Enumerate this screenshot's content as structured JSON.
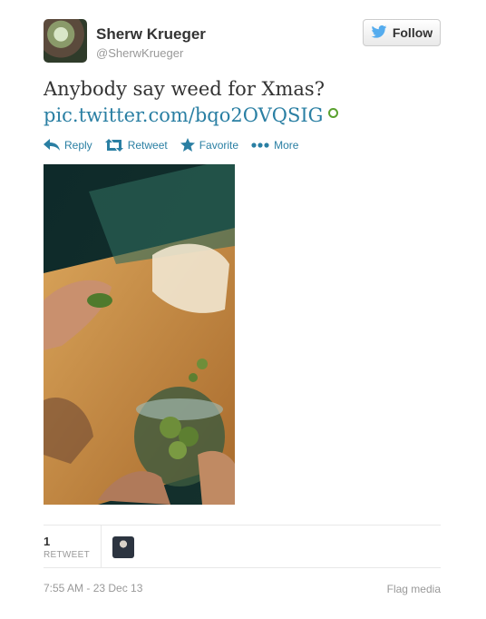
{
  "user": {
    "name": "Sherw Krueger",
    "handle": "@SherwKrueger"
  },
  "follow_button": {
    "label": "Follow"
  },
  "tweet": {
    "text": "Anybody say weed for Xmas?",
    "link": "pic.twitter.com/bqo2OVQSIG"
  },
  "actions": [
    {
      "label": "Reply",
      "icon": "reply-icon"
    },
    {
      "label": "Retweet",
      "icon": "retweet-icon"
    },
    {
      "label": "Favorite",
      "icon": "star-icon"
    },
    {
      "label": "More",
      "icon": "more-dots-icon"
    }
  ],
  "stats": {
    "retweet_count": "1",
    "retweet_label": "RETWEET"
  },
  "footer": {
    "timestamp": "7:55 AM - 23 Dec 13",
    "flag_media": "Flag media"
  },
  "colors": {
    "link": "#2a7fa3",
    "text": "#333333",
    "muted": "#999999",
    "twitter_blue": "#55acee"
  }
}
